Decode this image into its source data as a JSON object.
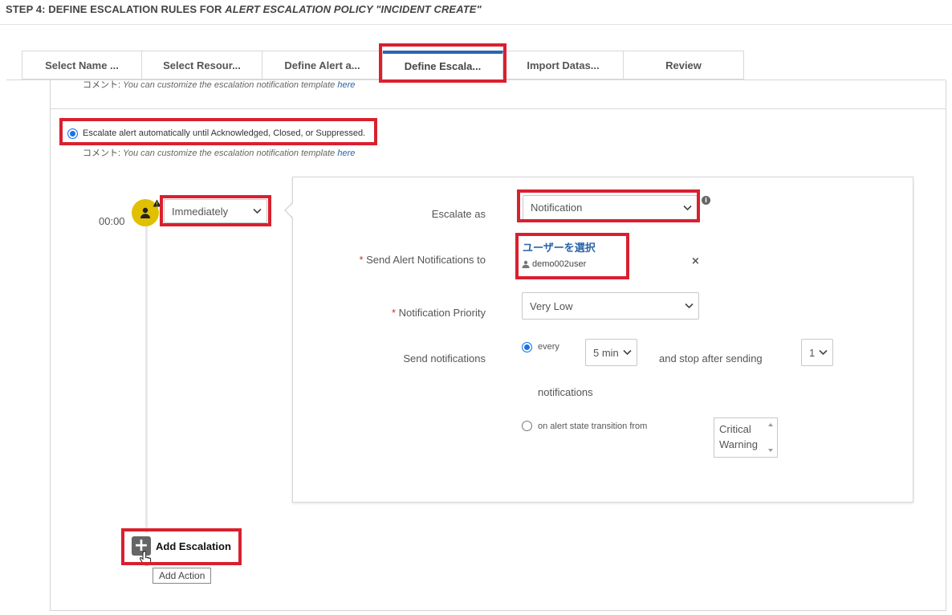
{
  "header": {
    "title_prefix": "STEP 4: DEFINE ESCALATION RULES FOR ",
    "title_emphasis": "ALERT ESCALATION POLICY \"INCIDENT CREATE\""
  },
  "tabs": [
    {
      "label": "Select Name ..."
    },
    {
      "label": "Select Resour..."
    },
    {
      "label": "Define Alert a..."
    },
    {
      "label": "Define Escala...",
      "active": true
    },
    {
      "label": "Import Datas..."
    },
    {
      "label": "Review"
    }
  ],
  "comment": {
    "prefix": "コメント: ",
    "text": "You can customize the escalation notification template ",
    "link": "here"
  },
  "escalate_auto": {
    "label": "Escalate alert automatically until Acknowledged, Closed, or Suppressed.",
    "selected": true
  },
  "timeline": {
    "time": "00:00",
    "delay_select": "Immediately"
  },
  "panel": {
    "escalate_as_label": "Escalate as",
    "escalate_as_value": "Notification",
    "send_to_label": "Send Alert Notifications to",
    "select_users_link": "ユーザーを選択",
    "selected_user": "demo002user",
    "remove_symbol": "×",
    "priority_label": "Notification Priority",
    "priority_value": "Very Low",
    "send_notifications_label": "Send notifications",
    "every_label": "every",
    "interval_value": "5 min",
    "stop_after_label": "and stop after sending",
    "count_value": "1",
    "notifications_label": "notifications",
    "transition_label": "on alert state transition from",
    "states": [
      "Critical",
      "Warning"
    ]
  },
  "actions": {
    "add_escalation": "Add Escalation",
    "tooltip": "Add Action"
  },
  "colors": {
    "highlight": "#d9202f",
    "accent": "#2b66b1",
    "link": "#2a64a8",
    "avatar": "#e0c000"
  }
}
